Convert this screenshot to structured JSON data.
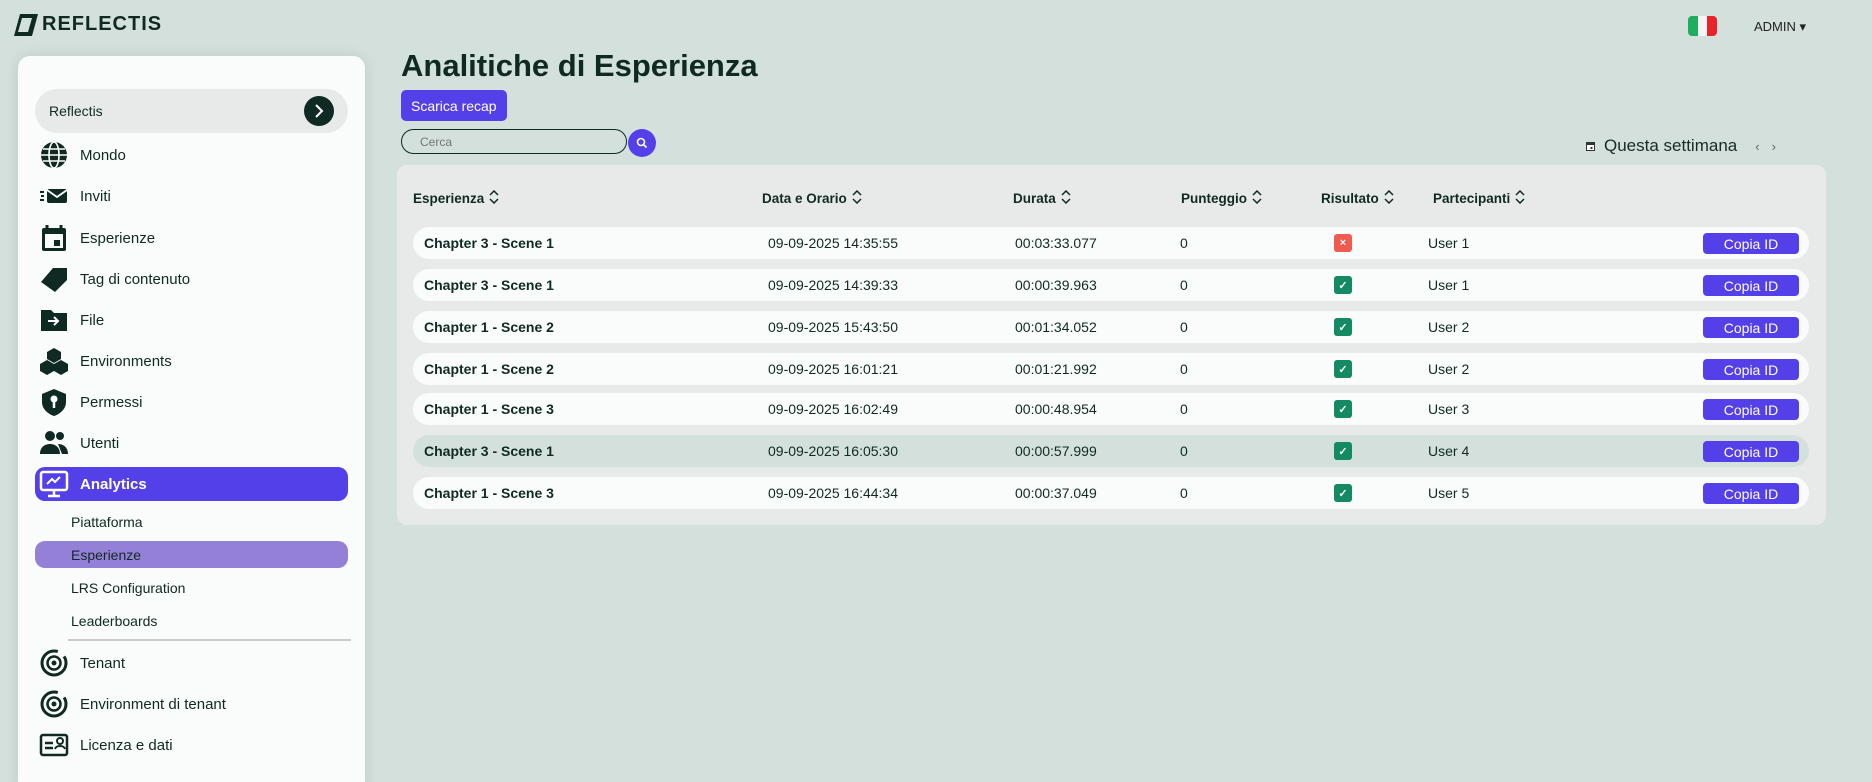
{
  "brand": {
    "name": "REFLECTIS"
  },
  "header": {
    "admin_label": "ADMIN ▾",
    "language": "it"
  },
  "sidebar": {
    "tenant": "Reflectis",
    "items": [
      {
        "label": "Mondo",
        "icon": "globe-icon"
      },
      {
        "label": "Inviti",
        "icon": "mail-fast-icon"
      },
      {
        "label": "Esperienze",
        "icon": "calendar-icon"
      },
      {
        "label": "Tag di contenuto",
        "icon": "tag-icon"
      },
      {
        "label": "File",
        "icon": "folder-arrow-icon"
      },
      {
        "label": "Environments",
        "icon": "cubes-icon"
      },
      {
        "label": "Permessi",
        "icon": "shield-key-icon"
      },
      {
        "label": "Utenti",
        "icon": "users-icon"
      },
      {
        "label": "Analytics",
        "icon": "monitor-chart-icon",
        "active": true
      }
    ],
    "subitems": [
      {
        "label": "Piattaforma"
      },
      {
        "label": "Esperienze",
        "active": true
      },
      {
        "label": "LRS Configuration"
      },
      {
        "label": "Leaderboards"
      }
    ],
    "bottom_items": [
      {
        "label": "Tenant",
        "icon": "target-icon"
      },
      {
        "label": "Environment di tenant",
        "icon": "target-icon"
      },
      {
        "label": "Licenza e dati",
        "icon": "license-icon"
      }
    ]
  },
  "main": {
    "title": "Analitiche di Esperienza",
    "download_label": "Scarica recap",
    "search_placeholder": "Cerca",
    "period": "Questa settimana",
    "columns": [
      "Esperienza",
      "Data e Orario",
      "Durata",
      "Punteggio",
      "Risultato",
      "Partecipanti"
    ],
    "copy_label": "Copia ID",
    "colors": {
      "accent": "#5440e8",
      "success": "#138a63",
      "fail": "#f05a4f"
    },
    "rows": [
      {
        "exp": "Chapter 3 - Scene 1",
        "date": "09-09-2025 14:35:55",
        "dur": "00:03:33.077",
        "score": "0",
        "ok": false,
        "user": "User 1"
      },
      {
        "exp": "Chapter 3 - Scene 1",
        "date": "09-09-2025 14:39:33",
        "dur": "00:00:39.963",
        "score": "0",
        "ok": true,
        "user": "User 1"
      },
      {
        "exp": "Chapter 1 - Scene 2",
        "date": "09-09-2025 15:43:50",
        "dur": "00:01:34.052",
        "score": "0",
        "ok": true,
        "user": "User 2"
      },
      {
        "exp": "Chapter 1 - Scene 2",
        "date": "09-09-2025 16:01:21",
        "dur": "00:01:21.992",
        "score": "0",
        "ok": true,
        "user": "User 2"
      },
      {
        "exp": "Chapter 1 - Scene 3",
        "date": "09-09-2025 16:02:49",
        "dur": "00:00:48.954",
        "score": "0",
        "ok": true,
        "user": "User 3"
      },
      {
        "exp": "Chapter 3 - Scene 1",
        "date": "09-09-2025 16:05:30",
        "dur": "00:00:57.999",
        "score": "0",
        "ok": true,
        "user": "User 4",
        "hover": true
      },
      {
        "exp": "Chapter 1 - Scene 3",
        "date": "09-09-2025 16:44:34",
        "dur": "00:00:37.049",
        "score": "0",
        "ok": true,
        "user": "User 5"
      }
    ]
  }
}
